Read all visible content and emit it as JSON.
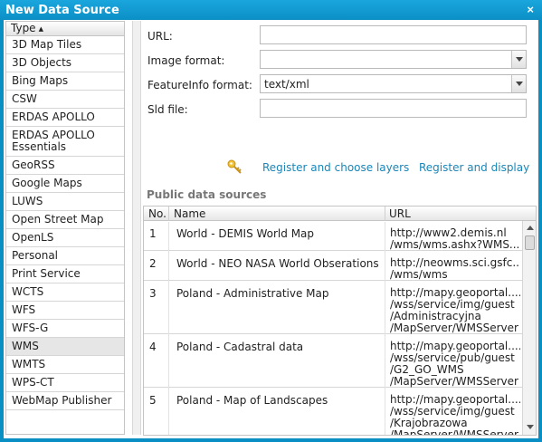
{
  "window": {
    "title": "New Data Source",
    "close_label": "×"
  },
  "types": {
    "header": "Type",
    "sort_indicator": "▲",
    "items": [
      "3D Map Tiles",
      "3D Objects",
      "Bing Maps",
      "CSW",
      "ERDAS APOLLO",
      "ERDAS APOLLO\nEssentials",
      "GeoRSS",
      "Google Maps",
      "LUWS",
      "Open Street Map",
      "OpenLS",
      "Personal",
      "Print Service",
      "WCTS",
      "WFS",
      "WFS-G",
      "WMS",
      "WMTS",
      "WPS-CT",
      "WebMap Publisher"
    ],
    "selected": "WMS"
  },
  "form": {
    "url_label": "URL:",
    "url_value": "",
    "image_format_label": "Image format:",
    "image_format_value": "",
    "featureinfo_format_label": "FeatureInfo format:",
    "featureinfo_format_value": "text/xml",
    "sld_label": "Sld file:",
    "sld_value": ""
  },
  "actions": {
    "key_icon": "key-icon",
    "register_choose_label": "Register and choose layers",
    "register_display_label": "Register and display"
  },
  "public_sources": {
    "heading": "Public data sources",
    "columns": [
      "No.",
      "Name",
      "URL"
    ],
    "rows": [
      {
        "no": "1",
        "name": "World - DEMIS World Map",
        "url": "http://www2.demis.nl\n/wms/wms.ashx?WMS..."
      },
      {
        "no": "2",
        "name": "World - NEO NASA World Obserations",
        "url": "http://neowms.sci.gsfc...\n/wms/wms"
      },
      {
        "no": "3",
        "name": "Poland - Administrative Map",
        "url": "http://mapy.geoportal....\n/wss/service/img/guest\n/Administracyjna\n/MapServer/WMSServer"
      },
      {
        "no": "4",
        "name": "Poland - Cadastral data",
        "url": "http://mapy.geoportal....\n/wss/service/pub/guest\n/G2_GO_WMS\n/MapServer/WMSServer"
      },
      {
        "no": "5",
        "name": "Poland - Map of Landscapes",
        "url": "http://mapy.geoportal....\n/wss/service/img/guest\n/Krajobrazowa\n/MapServer/WMSServer"
      }
    ]
  },
  "colors": {
    "title_bar": "#0b8fc5",
    "link": "#1a86b8",
    "selected_row": "#e6e6e6"
  }
}
